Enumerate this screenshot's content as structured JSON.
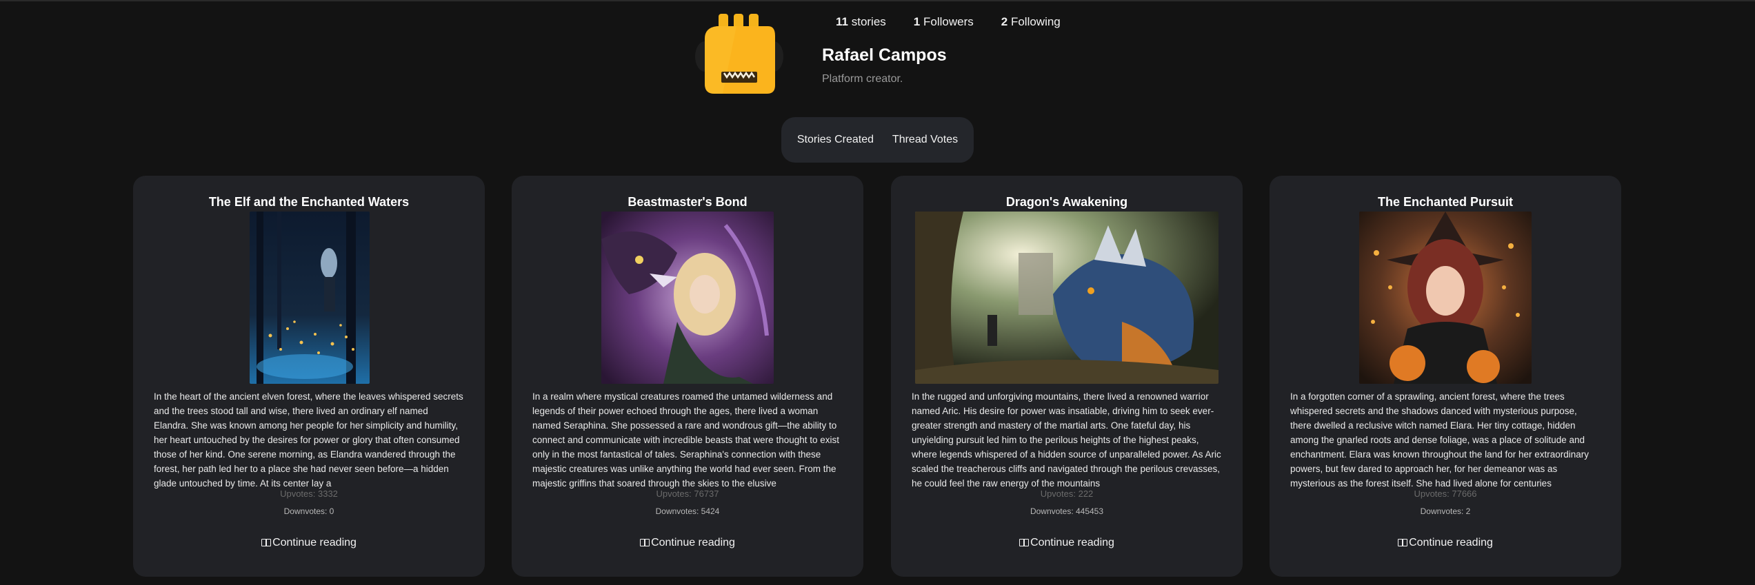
{
  "profile": {
    "stories_count": "11",
    "stories_label": "stories",
    "followers_count": "1",
    "followers_label": "Followers",
    "following_count": "2",
    "following_label": "Following",
    "name": "Rafael Campos",
    "bio": "Platform creator."
  },
  "tabs": [
    {
      "label": "Stories Created"
    },
    {
      "label": "Thread Votes"
    }
  ],
  "cards": [
    {
      "title": "The Elf and the Enchanted Waters",
      "excerpt": "In the heart of the ancient elven forest, where the leaves whispered secrets and the trees stood tall and wise, there lived an ordinary elf named Elandra. She was known among her people for her simplicity and humility, her heart untouched by the desires for power or glory that often consumed those of her kind. One serene morning, as Elandra wandered through the forest, her path led her to a place she had never seen before—a hidden glade untouched by time. At its center lay a",
      "upvotes": "Upvotes: 3332",
      "downvotes": "Downvotes: 0",
      "continue": "Continue reading"
    },
    {
      "title": "Beastmaster's Bond",
      "excerpt": "In a realm where mystical creatures roamed the untamed wilderness and legends of their power echoed through the ages, there lived a woman named Seraphina. She possessed a rare and wondrous gift—the ability to connect and communicate with incredible beasts that were thought to exist only in the most fantastical of tales. Seraphina's connection with these majestic creatures was unlike anything the world had ever seen. From the majestic griffins that soared through the skies to the elusive",
      "upvotes": "Upvotes: 76737",
      "downvotes": "Downvotes: 5424",
      "continue": "Continue reading"
    },
    {
      "title": "Dragon's Awakening",
      "excerpt": "In the rugged and unforgiving mountains, there lived a renowned warrior named Aric. His desire for power was insatiable, driving him to seek ever-greater strength and mastery of the martial arts. One fateful day, his unyielding pursuit led him to the perilous heights of the highest peaks, where legends whispered of a hidden source of unparalleled power. As Aric scaled the treacherous cliffs and navigated through the perilous crevasses, he could feel the raw energy of the mountains",
      "upvotes": "Upvotes: 222",
      "downvotes": "Downvotes: 445453",
      "continue": "Continue reading"
    },
    {
      "title": "The Enchanted Pursuit",
      "excerpt": "In a forgotten corner of a sprawling, ancient forest, where the trees whispered secrets and the shadows danced with mysterious purpose, there dwelled a reclusive witch named Elara. Her tiny cottage, hidden among the gnarled roots and dense foliage, was a place of solitude and enchantment. Elara was known throughout the land for her extraordinary powers, but few dared to approach her, for her demeanor was as mysterious as the forest itself. She had lived alone for centuries",
      "upvotes": "Upvotes: 77666",
      "downvotes": "Downvotes: 2",
      "continue": "Continue reading"
    }
  ]
}
